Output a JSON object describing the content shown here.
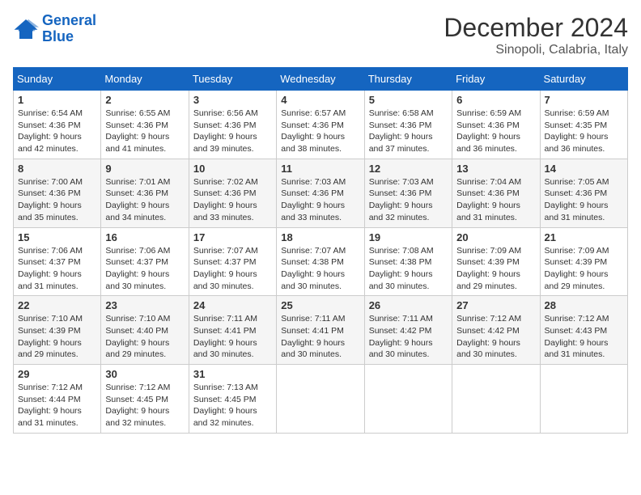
{
  "logo": {
    "text_general": "General",
    "text_blue": "Blue"
  },
  "title": "December 2024",
  "subtitle": "Sinopoli, Calabria, Italy",
  "days_of_week": [
    "Sunday",
    "Monday",
    "Tuesday",
    "Wednesday",
    "Thursday",
    "Friday",
    "Saturday"
  ],
  "weeks": [
    [
      {
        "day": "1",
        "sunrise": "6:54 AM",
        "sunset": "4:36 PM",
        "daylight": "9 hours and 42 minutes."
      },
      {
        "day": "2",
        "sunrise": "6:55 AM",
        "sunset": "4:36 PM",
        "daylight": "9 hours and 41 minutes."
      },
      {
        "day": "3",
        "sunrise": "6:56 AM",
        "sunset": "4:36 PM",
        "daylight": "9 hours and 39 minutes."
      },
      {
        "day": "4",
        "sunrise": "6:57 AM",
        "sunset": "4:36 PM",
        "daylight": "9 hours and 38 minutes."
      },
      {
        "day": "5",
        "sunrise": "6:58 AM",
        "sunset": "4:36 PM",
        "daylight": "9 hours and 37 minutes."
      },
      {
        "day": "6",
        "sunrise": "6:59 AM",
        "sunset": "4:36 PM",
        "daylight": "9 hours and 36 minutes."
      },
      {
        "day": "7",
        "sunrise": "6:59 AM",
        "sunset": "4:35 PM",
        "daylight": "9 hours and 36 minutes."
      }
    ],
    [
      {
        "day": "8",
        "sunrise": "7:00 AM",
        "sunset": "4:36 PM",
        "daylight": "9 hours and 35 minutes."
      },
      {
        "day": "9",
        "sunrise": "7:01 AM",
        "sunset": "4:36 PM",
        "daylight": "9 hours and 34 minutes."
      },
      {
        "day": "10",
        "sunrise": "7:02 AM",
        "sunset": "4:36 PM",
        "daylight": "9 hours and 33 minutes."
      },
      {
        "day": "11",
        "sunrise": "7:03 AM",
        "sunset": "4:36 PM",
        "daylight": "9 hours and 33 minutes."
      },
      {
        "day": "12",
        "sunrise": "7:03 AM",
        "sunset": "4:36 PM",
        "daylight": "9 hours and 32 minutes."
      },
      {
        "day": "13",
        "sunrise": "7:04 AM",
        "sunset": "4:36 PM",
        "daylight": "9 hours and 31 minutes."
      },
      {
        "day": "14",
        "sunrise": "7:05 AM",
        "sunset": "4:36 PM",
        "daylight": "9 hours and 31 minutes."
      }
    ],
    [
      {
        "day": "15",
        "sunrise": "7:06 AM",
        "sunset": "4:37 PM",
        "daylight": "9 hours and 31 minutes."
      },
      {
        "day": "16",
        "sunrise": "7:06 AM",
        "sunset": "4:37 PM",
        "daylight": "9 hours and 30 minutes."
      },
      {
        "day": "17",
        "sunrise": "7:07 AM",
        "sunset": "4:37 PM",
        "daylight": "9 hours and 30 minutes."
      },
      {
        "day": "18",
        "sunrise": "7:07 AM",
        "sunset": "4:38 PM",
        "daylight": "9 hours and 30 minutes."
      },
      {
        "day": "19",
        "sunrise": "7:08 AM",
        "sunset": "4:38 PM",
        "daylight": "9 hours and 30 minutes."
      },
      {
        "day": "20",
        "sunrise": "7:09 AM",
        "sunset": "4:39 PM",
        "daylight": "9 hours and 29 minutes."
      },
      {
        "day": "21",
        "sunrise": "7:09 AM",
        "sunset": "4:39 PM",
        "daylight": "9 hours and 29 minutes."
      }
    ],
    [
      {
        "day": "22",
        "sunrise": "7:10 AM",
        "sunset": "4:39 PM",
        "daylight": "9 hours and 29 minutes."
      },
      {
        "day": "23",
        "sunrise": "7:10 AM",
        "sunset": "4:40 PM",
        "daylight": "9 hours and 29 minutes."
      },
      {
        "day": "24",
        "sunrise": "7:11 AM",
        "sunset": "4:41 PM",
        "daylight": "9 hours and 30 minutes."
      },
      {
        "day": "25",
        "sunrise": "7:11 AM",
        "sunset": "4:41 PM",
        "daylight": "9 hours and 30 minutes."
      },
      {
        "day": "26",
        "sunrise": "7:11 AM",
        "sunset": "4:42 PM",
        "daylight": "9 hours and 30 minutes."
      },
      {
        "day": "27",
        "sunrise": "7:12 AM",
        "sunset": "4:42 PM",
        "daylight": "9 hours and 30 minutes."
      },
      {
        "day": "28",
        "sunrise": "7:12 AM",
        "sunset": "4:43 PM",
        "daylight": "9 hours and 31 minutes."
      }
    ],
    [
      {
        "day": "29",
        "sunrise": "7:12 AM",
        "sunset": "4:44 PM",
        "daylight": "9 hours and 31 minutes."
      },
      {
        "day": "30",
        "sunrise": "7:12 AM",
        "sunset": "4:45 PM",
        "daylight": "9 hours and 32 minutes."
      },
      {
        "day": "31",
        "sunrise": "7:13 AM",
        "sunset": "4:45 PM",
        "daylight": "9 hours and 32 minutes."
      },
      null,
      null,
      null,
      null
    ]
  ],
  "labels": {
    "sunrise": "Sunrise:",
    "sunset": "Sunset:",
    "daylight": "Daylight:"
  }
}
